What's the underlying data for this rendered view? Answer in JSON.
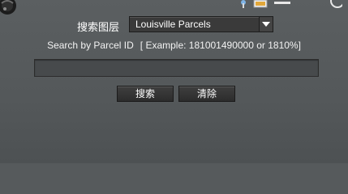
{
  "layer": {
    "label": "搜索图层",
    "selected": "Louisville Parcels"
  },
  "hint": {
    "main": "Search by Parcel ID",
    "example": "[ Example: 181001490000 or 1810%]"
  },
  "input": {
    "value": "",
    "placeholder": ""
  },
  "buttons": {
    "search": "搜索",
    "clear": "清除"
  },
  "icons": {
    "corner": "globe-decoration-icon",
    "toolbar": [
      "pin-icon",
      "map-icon",
      "line-icon",
      "circle-icon"
    ]
  },
  "colors": {
    "panel": "#565a5c",
    "text": "#ffffff",
    "control": "#3a3a3a"
  }
}
